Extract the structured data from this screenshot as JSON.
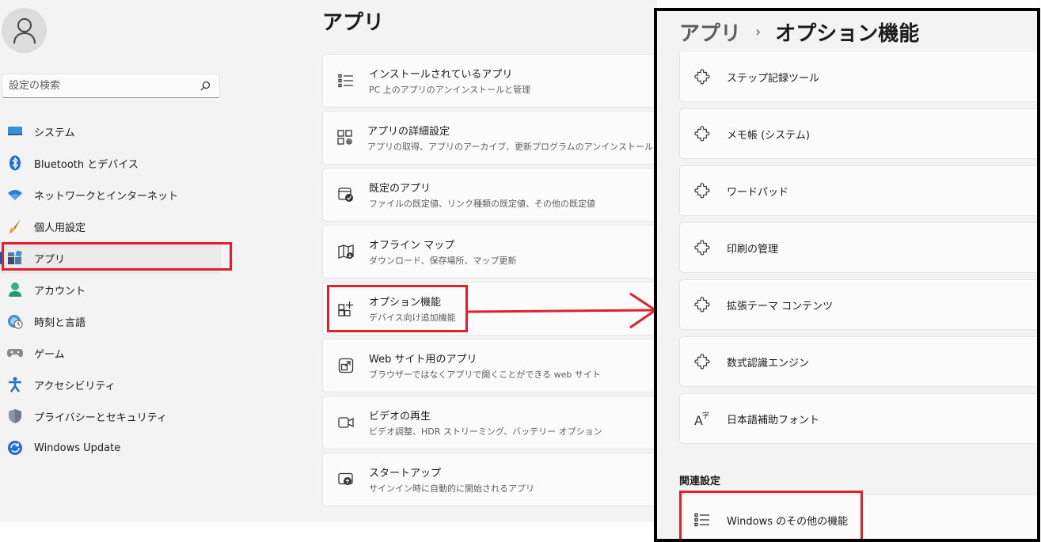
{
  "left": {
    "search": {
      "placeholder": "設定の検索"
    },
    "nav": [
      {
        "label": "システム",
        "icon": "system-icon"
      },
      {
        "label": "Bluetooth とデバイス",
        "icon": "bluetooth-icon"
      },
      {
        "label": "ネットワークとインターネット",
        "icon": "wifi-icon"
      },
      {
        "label": "個人用設定",
        "icon": "brush-icon"
      },
      {
        "label": "アプリ",
        "icon": "apps-icon",
        "selected": true
      },
      {
        "label": "アカウント",
        "icon": "account-icon"
      },
      {
        "label": "時刻と言語",
        "icon": "globe-clock-icon"
      },
      {
        "label": "ゲーム",
        "icon": "gamepad-icon"
      },
      {
        "label": "アクセシビリティ",
        "icon": "accessibility-icon"
      },
      {
        "label": "プライバシーとセキュリティ",
        "icon": "shield-icon"
      },
      {
        "label": "Windows Update",
        "icon": "update-icon"
      }
    ],
    "page_title": "アプリ",
    "cards": [
      {
        "title": "インストールされているアプリ",
        "sub": "PC 上のアプリのアンインストールと管理",
        "icon": "list-icon"
      },
      {
        "title": "アプリの詳細設定",
        "sub": "アプリの取得、アプリのアーカイブ、更新プログラムのアンインストールを行う場所を",
        "icon": "app-settings-icon"
      },
      {
        "title": "既定のアプリ",
        "sub": "ファイルの既定値、リンク種類の既定値、その他の既定値",
        "icon": "default-apps-icon"
      },
      {
        "title": "オフライン マップ",
        "sub": "ダウンロード、保存場所、マップ更新",
        "icon": "map-icon"
      },
      {
        "title": "オプション機能",
        "sub": "デバイス向け追加機能",
        "icon": "optional-features-icon"
      },
      {
        "title": "Web サイト用のアプリ",
        "sub": "ブラウザーではなくアプリで開くことができる web サイト",
        "icon": "open-external-icon"
      },
      {
        "title": "ビデオの再生",
        "sub": "ビデオ調整、HDR ストリーミング、バッテリー オプション",
        "icon": "video-icon"
      },
      {
        "title": "スタートアップ",
        "sub": "サインイン時に自動的に開始されるアプリ",
        "icon": "startup-icon"
      }
    ]
  },
  "right": {
    "breadcrumb": {
      "parent": "アプリ",
      "separator": "›",
      "current": "オプション機能"
    },
    "features": [
      {
        "label": "ステップ記録ツール",
        "icon": "puzzle-icon"
      },
      {
        "label": "メモ帳 (システム)",
        "icon": "puzzle-icon"
      },
      {
        "label": "ワードパッド",
        "icon": "puzzle-icon"
      },
      {
        "label": "印刷の管理",
        "icon": "puzzle-icon"
      },
      {
        "label": "拡張テーマ コンテンツ",
        "icon": "puzzle-icon"
      },
      {
        "label": "数式認識エンジン",
        "icon": "puzzle-icon"
      },
      {
        "label": "日本語補助フォント",
        "icon": "font-icon"
      }
    ],
    "related_title": "関連設定",
    "related_link": {
      "label": "Windows のその他の機能",
      "icon": "list-icon"
    }
  },
  "colors": {
    "highlight": "#e0202a",
    "accent": "#005fb8",
    "frame": "#000000"
  }
}
